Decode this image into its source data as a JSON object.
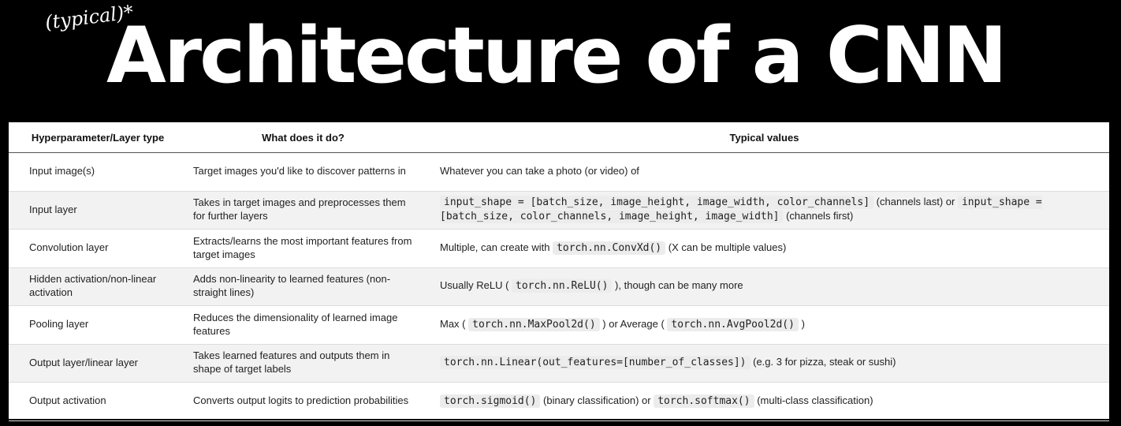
{
  "title": "Architecture of a CNN",
  "title_note": "(typical)*",
  "table": {
    "headers": [
      "Hyperparameter/Layer type",
      "What does it do?",
      "Typical values"
    ],
    "rows": [
      {
        "layer": "Input image(s)",
        "purpose": "Target images you'd like to discover patterns in",
        "values": [
          {
            "text": "Whatever you can take a photo (or video) of"
          }
        ]
      },
      {
        "layer": "Input layer",
        "purpose": "Takes in target images and preprocesses them for further layers",
        "values": [
          {
            "code": "input_shape = [batch_size, image_height, image_width, color_channels]"
          },
          {
            "text": " (channels last) or "
          },
          {
            "code": "input_shape = [batch_size, color_channels, image_height, image_width]"
          },
          {
            "text": " (channels first)"
          }
        ]
      },
      {
        "layer": "Convolution layer",
        "purpose": "Extracts/learns the most important features from target images",
        "values": [
          {
            "text": "Multiple, can create with "
          },
          {
            "code": "torch.nn.ConvXd()"
          },
          {
            "text": " (X can be multiple values)"
          }
        ]
      },
      {
        "layer": "Hidden activation/non-linear activation",
        "purpose": "Adds non-linearity to learned features (non-straight lines)",
        "values": [
          {
            "text": "Usually ReLU ( "
          },
          {
            "code": "torch.nn.ReLU()"
          },
          {
            "text": " ), though can be many more"
          }
        ]
      },
      {
        "layer": "Pooling layer",
        "purpose": "Reduces the dimensionality of learned image features",
        "values": [
          {
            "text": "Max ( "
          },
          {
            "code": "torch.nn.MaxPool2d()"
          },
          {
            "text": " ) or Average ( "
          },
          {
            "code": "torch.nn.AvgPool2d()"
          },
          {
            "text": " )"
          }
        ]
      },
      {
        "layer": "Output layer/linear layer",
        "purpose": "Takes learned features and outputs them in shape of target labels",
        "values": [
          {
            "code": "torch.nn.Linear(out_features=[number_of_classes])"
          },
          {
            "text": " (e.g. 3 for pizza, steak or sushi)"
          }
        ]
      },
      {
        "layer": "Output activation",
        "purpose": "Converts output logits to prediction probabilities",
        "values": [
          {
            "code": "torch.sigmoid()"
          },
          {
            "text": " (binary classification) or "
          },
          {
            "code": "torch.softmax()"
          },
          {
            "text": " (multi-class classification)"
          }
        ]
      }
    ]
  }
}
